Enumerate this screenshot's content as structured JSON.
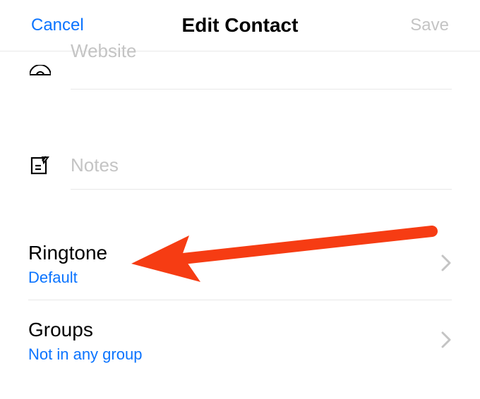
{
  "header": {
    "cancel_label": "Cancel",
    "title": "Edit Contact",
    "save_label": "Save"
  },
  "fields": {
    "website": {
      "placeholder": "Website"
    },
    "notes": {
      "placeholder": "Notes"
    }
  },
  "settings": {
    "ringtone": {
      "label": "Ringtone",
      "value": "Default"
    },
    "groups": {
      "label": "Groups",
      "value": "Not in any group"
    }
  },
  "annotation": {
    "arrow_color": "#f63c13"
  }
}
